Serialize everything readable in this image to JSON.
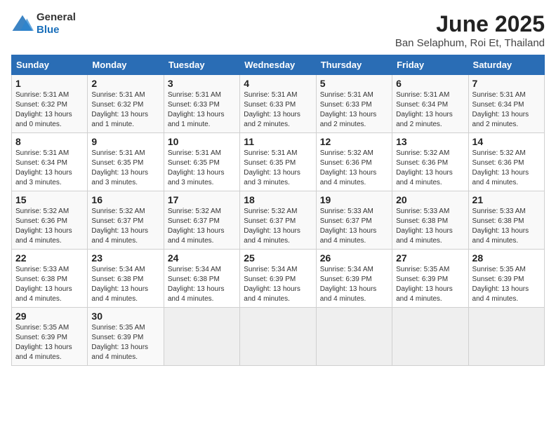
{
  "logo": {
    "general": "General",
    "blue": "Blue"
  },
  "title": "June 2025",
  "subtitle": "Ban Selaphum, Roi Et, Thailand",
  "days_of_week": [
    "Sunday",
    "Monday",
    "Tuesday",
    "Wednesday",
    "Thursday",
    "Friday",
    "Saturday"
  ],
  "weeks": [
    [
      {
        "day": "1",
        "sunrise": "5:31 AM",
        "sunset": "6:32 PM",
        "daylight": "13 hours and 0 minutes."
      },
      {
        "day": "2",
        "sunrise": "5:31 AM",
        "sunset": "6:32 PM",
        "daylight": "13 hours and 1 minute."
      },
      {
        "day": "3",
        "sunrise": "5:31 AM",
        "sunset": "6:33 PM",
        "daylight": "13 hours and 1 minute."
      },
      {
        "day": "4",
        "sunrise": "5:31 AM",
        "sunset": "6:33 PM",
        "daylight": "13 hours and 2 minutes."
      },
      {
        "day": "5",
        "sunrise": "5:31 AM",
        "sunset": "6:33 PM",
        "daylight": "13 hours and 2 minutes."
      },
      {
        "day": "6",
        "sunrise": "5:31 AM",
        "sunset": "6:34 PM",
        "daylight": "13 hours and 2 minutes."
      },
      {
        "day": "7",
        "sunrise": "5:31 AM",
        "sunset": "6:34 PM",
        "daylight": "13 hours and 2 minutes."
      }
    ],
    [
      {
        "day": "8",
        "sunrise": "5:31 AM",
        "sunset": "6:34 PM",
        "daylight": "13 hours and 3 minutes."
      },
      {
        "day": "9",
        "sunrise": "5:31 AM",
        "sunset": "6:35 PM",
        "daylight": "13 hours and 3 minutes."
      },
      {
        "day": "10",
        "sunrise": "5:31 AM",
        "sunset": "6:35 PM",
        "daylight": "13 hours and 3 minutes."
      },
      {
        "day": "11",
        "sunrise": "5:31 AM",
        "sunset": "6:35 PM",
        "daylight": "13 hours and 3 minutes."
      },
      {
        "day": "12",
        "sunrise": "5:32 AM",
        "sunset": "6:36 PM",
        "daylight": "13 hours and 4 minutes."
      },
      {
        "day": "13",
        "sunrise": "5:32 AM",
        "sunset": "6:36 PM",
        "daylight": "13 hours and 4 minutes."
      },
      {
        "day": "14",
        "sunrise": "5:32 AM",
        "sunset": "6:36 PM",
        "daylight": "13 hours and 4 minutes."
      }
    ],
    [
      {
        "day": "15",
        "sunrise": "5:32 AM",
        "sunset": "6:36 PM",
        "daylight": "13 hours and 4 minutes."
      },
      {
        "day": "16",
        "sunrise": "5:32 AM",
        "sunset": "6:37 PM",
        "daylight": "13 hours and 4 minutes."
      },
      {
        "day": "17",
        "sunrise": "5:32 AM",
        "sunset": "6:37 PM",
        "daylight": "13 hours and 4 minutes."
      },
      {
        "day": "18",
        "sunrise": "5:32 AM",
        "sunset": "6:37 PM",
        "daylight": "13 hours and 4 minutes."
      },
      {
        "day": "19",
        "sunrise": "5:33 AM",
        "sunset": "6:37 PM",
        "daylight": "13 hours and 4 minutes."
      },
      {
        "day": "20",
        "sunrise": "5:33 AM",
        "sunset": "6:38 PM",
        "daylight": "13 hours and 4 minutes."
      },
      {
        "day": "21",
        "sunrise": "5:33 AM",
        "sunset": "6:38 PM",
        "daylight": "13 hours and 4 minutes."
      }
    ],
    [
      {
        "day": "22",
        "sunrise": "5:33 AM",
        "sunset": "6:38 PM",
        "daylight": "13 hours and 4 minutes."
      },
      {
        "day": "23",
        "sunrise": "5:34 AM",
        "sunset": "6:38 PM",
        "daylight": "13 hours and 4 minutes."
      },
      {
        "day": "24",
        "sunrise": "5:34 AM",
        "sunset": "6:38 PM",
        "daylight": "13 hours and 4 minutes."
      },
      {
        "day": "25",
        "sunrise": "5:34 AM",
        "sunset": "6:39 PM",
        "daylight": "13 hours and 4 minutes."
      },
      {
        "day": "26",
        "sunrise": "5:34 AM",
        "sunset": "6:39 PM",
        "daylight": "13 hours and 4 minutes."
      },
      {
        "day": "27",
        "sunrise": "5:35 AM",
        "sunset": "6:39 PM",
        "daylight": "13 hours and 4 minutes."
      },
      {
        "day": "28",
        "sunrise": "5:35 AM",
        "sunset": "6:39 PM",
        "daylight": "13 hours and 4 minutes."
      }
    ],
    [
      {
        "day": "29",
        "sunrise": "5:35 AM",
        "sunset": "6:39 PM",
        "daylight": "13 hours and 4 minutes."
      },
      {
        "day": "30",
        "sunrise": "5:35 AM",
        "sunset": "6:39 PM",
        "daylight": "13 hours and 4 minutes."
      },
      null,
      null,
      null,
      null,
      null
    ]
  ],
  "labels": {
    "sunrise": "Sunrise:",
    "sunset": "Sunset:",
    "daylight": "Daylight:"
  }
}
